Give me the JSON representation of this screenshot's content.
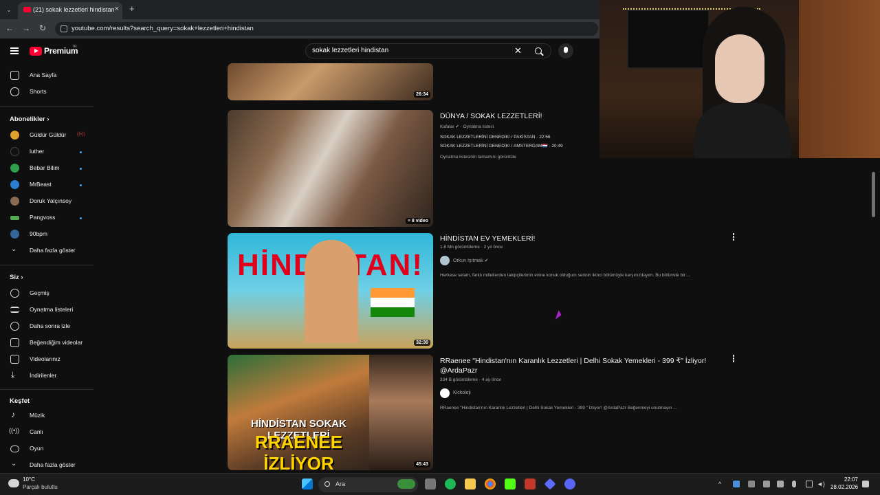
{
  "browser": {
    "tab_title": "(21) sokak lezzetleri hindistan",
    "url": "youtube.com/results?search_query=sokak+lezzetleri+hindistan"
  },
  "header": {
    "brand": "Premium",
    "brand_sup": "TR",
    "search_query": "sokak lezzetleri hindistan"
  },
  "sidebar": {
    "main": [
      {
        "label": "Ana Sayfa",
        "icon": "home-icon"
      },
      {
        "label": "Shorts",
        "icon": "shorts-icon"
      }
    ],
    "subscriptions_heading": "Abonelikler",
    "subscriptions": [
      {
        "label": "Güldür Güldür",
        "color": "#e0a030",
        "badge": "live"
      },
      {
        "label": "luther",
        "color": "#111111",
        "badge": "dot"
      },
      {
        "label": "Bebar Bilim",
        "color": "#2e9e4a",
        "badge": "dot"
      },
      {
        "label": "MrBeast",
        "color": "#2a7fd0",
        "badge": "dot"
      },
      {
        "label": "Doruk Yalçınsoy",
        "color": "#8a6a50",
        "badge": ""
      },
      {
        "label": "Pangvoss",
        "color": "#55aa55",
        "badge": "dot"
      },
      {
        "label": "90bpm",
        "color": "#336699",
        "badge": ""
      }
    ],
    "show_more": "Daha fazla göster",
    "you_heading": "Siz",
    "you": [
      {
        "label": "Geçmiş",
        "icon": "history-icon"
      },
      {
        "label": "Oynatma listeleri",
        "icon": "playlists-icon"
      },
      {
        "label": "Daha sonra izle",
        "icon": "watch-later-icon"
      },
      {
        "label": "Beğendiğim videolar",
        "icon": "like-icon"
      },
      {
        "label": "Videolarınız",
        "icon": "your-videos-icon"
      },
      {
        "label": "İndirilenler",
        "icon": "download-icon"
      }
    ],
    "explore_heading": "Keşfet",
    "explore": [
      {
        "label": "Müzik",
        "icon": "music-icon"
      },
      {
        "label": "Canlı",
        "icon": "live-icon"
      },
      {
        "label": "Oyun",
        "icon": "gaming-icon"
      }
    ],
    "show_more_2": "Daha fazla göster"
  },
  "results": {
    "partial_duration": "26:34",
    "playlist": {
      "title": "DÜNYA / SOKAK LEZZETLERİ!",
      "channel": "Kafalar",
      "type": "Oynatma listesi",
      "line1": "SOKAK LEZZETLERİNİ DENEDİK! / PAKİSTAN · 22:56",
      "line2": "SOKAK LEZZETLERİNİ DENEDİK! / AMSTERDAM🇳🇱 · 20:49",
      "view_all": "Oynatma listesinin tamamını görüntüle",
      "count": "8 video"
    },
    "video1": {
      "title": "HİNDİSTAN EV YEMEKLERİ!",
      "meta": "1,8 Mn görüntüleme · 2 yıl önce",
      "channel": "Orkun Işıtmak",
      "desc": "Herkese selam, farklı milletlerden takipçilerimin evine konuk olduğum serinin ikinci bölümüyle karşınızdayım. Bu bölümde bir ...",
      "duration": "32:30",
      "thumb_text": "HİNDİSTAN!"
    },
    "video2": {
      "title": "RRaenee \"Hindistan'nın Karanlık Lezzetleri | Delhi Sokak Yemekleri - 399 ₹\" İzliyor! @ArdaPazr",
      "meta": "334 B görüntüleme · 4 ay önce",
      "channel": "Kickoloji",
      "desc": "RRaenee \"Hindistan'nın Karanlık Lezzetleri | Delhi Sokak Yemekleri - 399 \" İzliyor! @ArdaPazr Beğenmeyi unutmayın ...",
      "duration": "45:43",
      "thumb_line1": "HİNDİSTAN SOKAK LEZZETLERİ",
      "thumb_line2": "RRAENEE İZLİYOR"
    }
  },
  "taskbar": {
    "temp": "10°C",
    "weather": "Parçalı bulutlu",
    "search": "Ara",
    "time": "22:07",
    "date": "28.02.2026"
  }
}
